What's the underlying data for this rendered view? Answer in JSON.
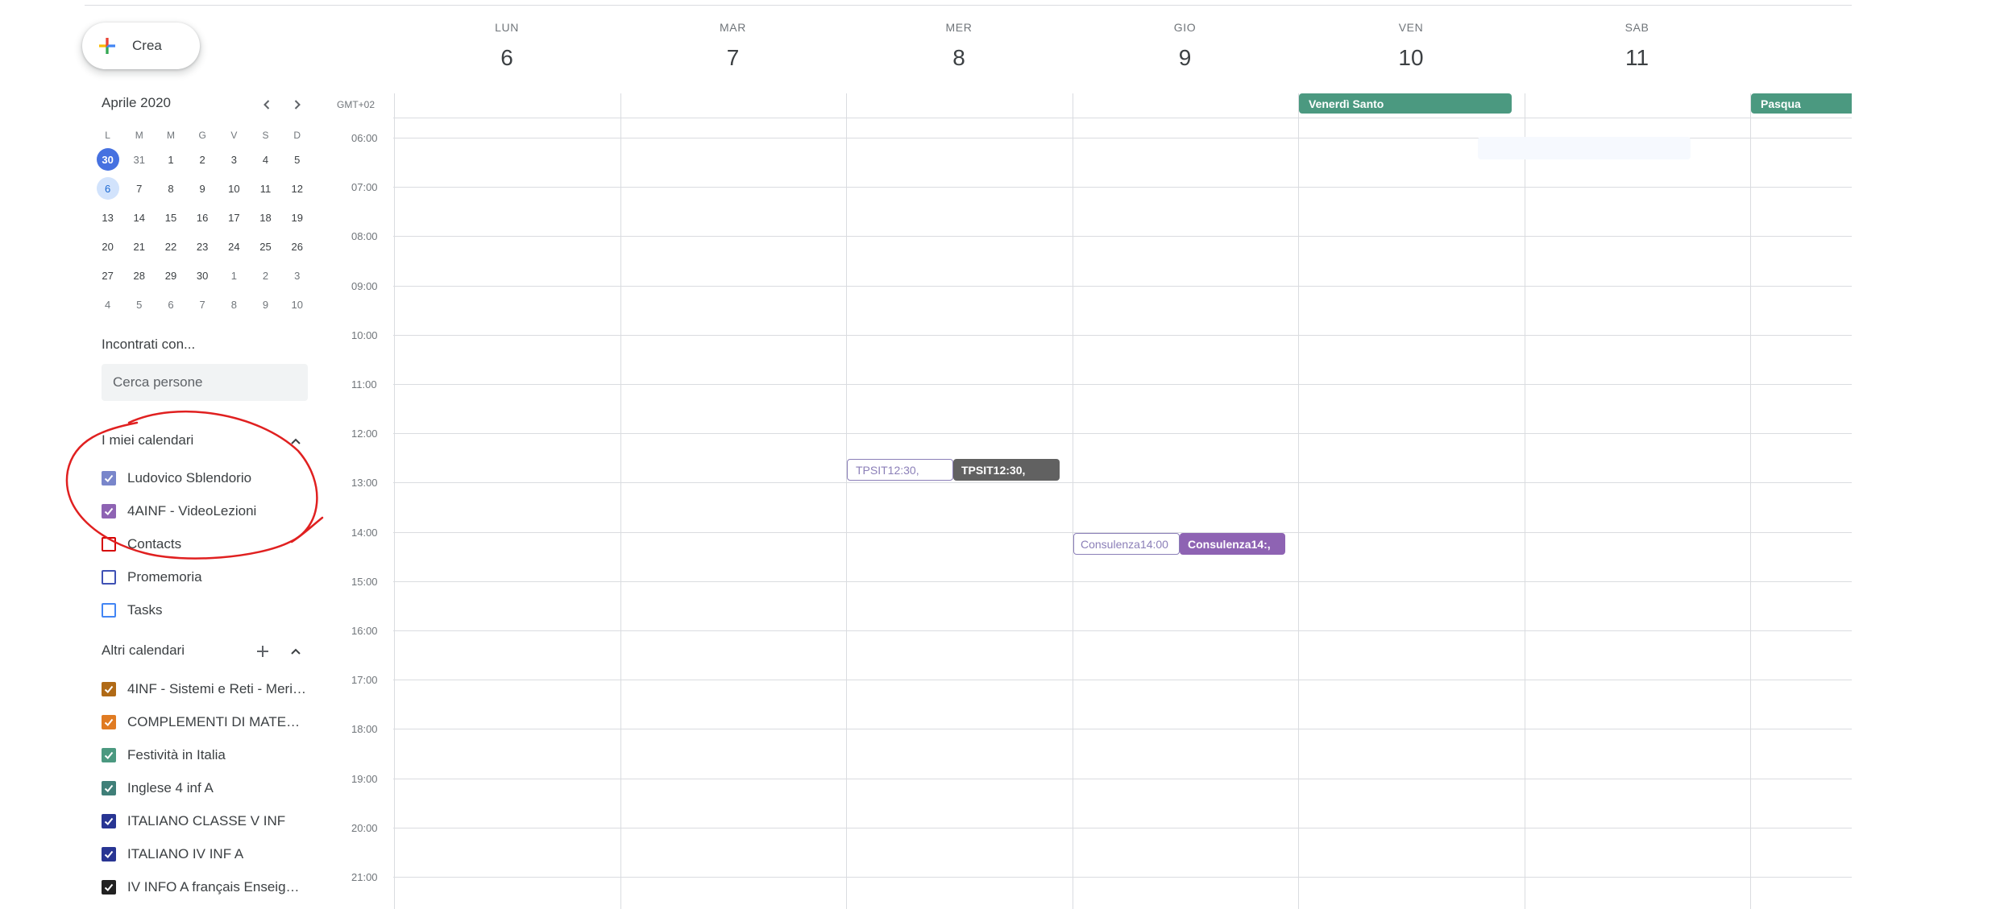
{
  "create_button": {
    "label": "Crea"
  },
  "mini_calendar": {
    "month_label": "Aprile 2020",
    "weekday_headers": [
      "L",
      "M",
      "M",
      "G",
      "V",
      "S",
      "D"
    ],
    "weeks": [
      [
        "30",
        "31",
        "1",
        "2",
        "3",
        "4",
        "5"
      ],
      [
        "6",
        "7",
        "8",
        "9",
        "10",
        "11",
        "12"
      ],
      [
        "13",
        "14",
        "15",
        "16",
        "17",
        "18",
        "19"
      ],
      [
        "20",
        "21",
        "22",
        "23",
        "24",
        "25",
        "26"
      ],
      [
        "27",
        "28",
        "29",
        "30",
        "1",
        "2",
        "3"
      ],
      [
        "4",
        "5",
        "6",
        "7",
        "8",
        "9",
        "10"
      ]
    ],
    "today": "30",
    "selected": "6"
  },
  "meet_with": {
    "title": "Incontrati con...",
    "placeholder": "Cerca persone"
  },
  "my_calendars": {
    "title": "I miei calendari",
    "items": [
      {
        "label": "Ludovico Sblendorio",
        "checked": true,
        "color": "#7986cb"
      },
      {
        "label": "4AINF - VideoLezioni",
        "checked": true,
        "color": "#8e63b3"
      },
      {
        "label": "Contacts",
        "checked": false,
        "color": "#d50000"
      },
      {
        "label": "Promemoria",
        "checked": false,
        "color": "#3f51b5"
      },
      {
        "label": "Tasks",
        "checked": false,
        "color": "#4285f4"
      }
    ]
  },
  "other_calendars": {
    "title": "Altri calendari",
    "items": [
      {
        "label": "4INF - Sistemi e Reti - Meri…",
        "checked": true,
        "color": "#b06a16"
      },
      {
        "label": "COMPLEMENTI DI MATE…",
        "checked": true,
        "color": "#e07b22"
      },
      {
        "label": "Festività in Italia",
        "checked": true,
        "color": "#4b9980"
      },
      {
        "label": "Inglese 4 inf A",
        "checked": true,
        "color": "#3f7f78"
      },
      {
        "label": "ITALIANO CLASSE V INF",
        "checked": true,
        "color": "#283593"
      },
      {
        "label": "ITALIANO IV INF A",
        "checked": true,
        "color": "#283593"
      },
      {
        "label": "IV INFO A français Enseig…",
        "checked": true,
        "color": "#212121"
      }
    ]
  },
  "week": {
    "timezone": "GMT+02",
    "days": [
      {
        "dow": "LUN",
        "num": "6"
      },
      {
        "dow": "MAR",
        "num": "7"
      },
      {
        "dow": "MER",
        "num": "8"
      },
      {
        "dow": "GIO",
        "num": "9"
      },
      {
        "dow": "VEN",
        "num": "10"
      },
      {
        "dow": "SAB",
        "num": "11"
      }
    ],
    "hours": [
      "06:00",
      "07:00",
      "08:00",
      "09:00",
      "10:00",
      "11:00",
      "12:00",
      "13:00",
      "14:00",
      "15:00",
      "16:00",
      "17:00",
      "18:00",
      "19:00",
      "20:00",
      "21:00"
    ]
  },
  "all_day_events": [
    {
      "label": "Venerdì Santo",
      "color": "#4b9980"
    },
    {
      "label": "Pasqua",
      "color": "#4b9980"
    }
  ],
  "events": [
    {
      "label": "TPSIT12:30,",
      "style": "outline"
    },
    {
      "label": "TPSIT12:30,",
      "style": "dark"
    },
    {
      "label": "Consulenza14:00",
      "style": "outline"
    },
    {
      "label": "Consulenza14:,",
      "style": "purple"
    }
  ]
}
